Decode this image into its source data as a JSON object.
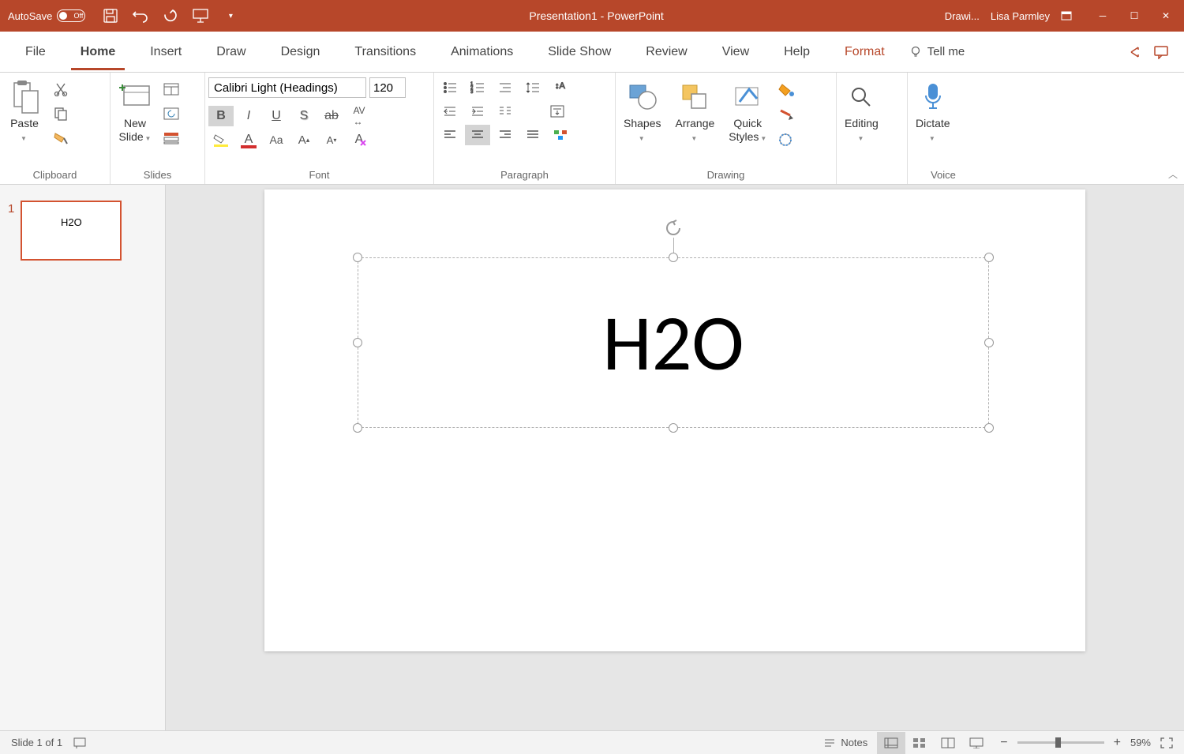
{
  "titlebar": {
    "autosave_label": "AutoSave",
    "autosave_state": "Off",
    "title": "Presentation1  -  PowerPoint",
    "context_tab": "Drawi...",
    "user": "Lisa Parmley"
  },
  "tabs": [
    "File",
    "Home",
    "Insert",
    "Draw",
    "Design",
    "Transitions",
    "Animations",
    "Slide Show",
    "Review",
    "View",
    "Help",
    "Format"
  ],
  "active_tab": "Home",
  "tellme": "Tell me",
  "ribbon": {
    "clipboard": {
      "paste": "Paste",
      "label": "Clipboard"
    },
    "slides": {
      "new_slide": "New\nSlide",
      "label": "Slides"
    },
    "font": {
      "font_name": "Calibri Light (Headings)",
      "font_size": "120",
      "label": "Font"
    },
    "paragraph": {
      "label": "Paragraph"
    },
    "drawing": {
      "shapes": "Shapes",
      "arrange": "Arrange",
      "quick_styles": "Quick\nStyles",
      "label": "Drawing"
    },
    "editing": {
      "label": "Editing",
      "btn": "Editing"
    },
    "voice": {
      "dictate": "Dictate",
      "label": "Voice"
    }
  },
  "thumbnail": {
    "num": "1",
    "text": "H2O"
  },
  "slide": {
    "text": "H2O"
  },
  "statusbar": {
    "slide_info": "Slide 1 of 1",
    "notes": "Notes",
    "zoom": "59%"
  }
}
